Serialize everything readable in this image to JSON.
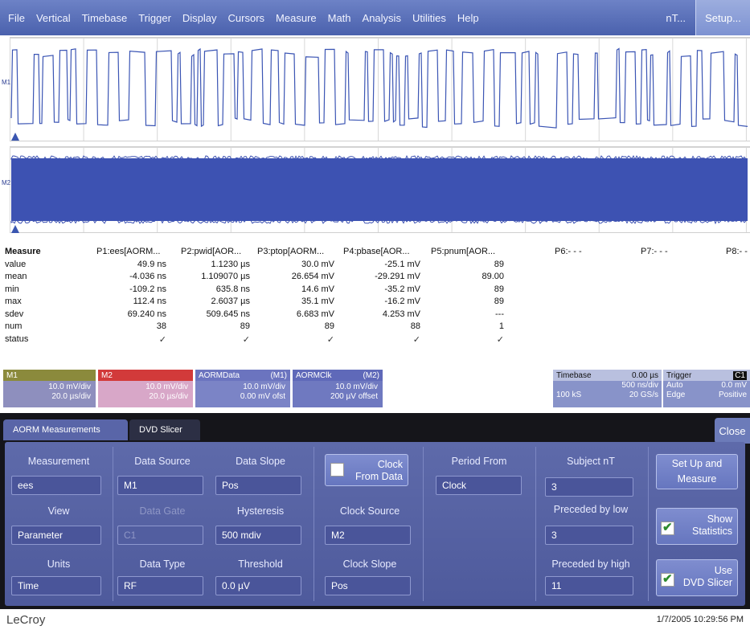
{
  "menu": {
    "items": [
      "File",
      "Vertical",
      "Timebase",
      "Trigger",
      "Display",
      "Cursors",
      "Measure",
      "Math",
      "Analysis",
      "Utilities",
      "Help"
    ],
    "nt_label": "nT...",
    "setup_label": "Setup..."
  },
  "waveforms": {
    "ch1_tag": "M1",
    "ch2_tag": "M2"
  },
  "measure": {
    "heading": "Measure",
    "params": [
      "P1:ees[AORM...",
      "P2:pwid[AOR...",
      "P3:ptop[AORM...",
      "P4:pbase[AOR...",
      "P5:pnum[AOR...",
      "P6:- - -",
      "P7:- - -",
      "P8:- -"
    ],
    "rows": [
      {
        "label": "value",
        "cells": [
          "49.9 ns",
          "1.1230 µs",
          "30.0 mV",
          "-25.1 mV",
          "89"
        ]
      },
      {
        "label": "mean",
        "cells": [
          "-4.036 ns",
          "1.109070 µs",
          "26.654 mV",
          "-29.291 mV",
          "89.00"
        ]
      },
      {
        "label": "min",
        "cells": [
          "-109.2 ns",
          "635.8 ns",
          "14.6 mV",
          "-35.2 mV",
          "89"
        ]
      },
      {
        "label": "max",
        "cells": [
          "112.4 ns",
          "2.6037 µs",
          "35.1 mV",
          "-16.2 mV",
          "89"
        ]
      },
      {
        "label": "sdev",
        "cells": [
          "69.240 ns",
          "509.645 ns",
          "6.683 mV",
          "4.253 mV",
          "---"
        ]
      },
      {
        "label": "num",
        "cells": [
          "38",
          "89",
          "89",
          "88",
          "1"
        ]
      },
      {
        "label": "status",
        "cells": [
          "✓",
          "✓",
          "✓",
          "✓",
          "✓"
        ]
      }
    ]
  },
  "descriptors": {
    "m1": {
      "name": "M1",
      "line1": "10.0 mV/div",
      "line2": "20.0 µs/div",
      "header_color": "#8b8a3c"
    },
    "m2": {
      "name": "M2",
      "line1": "10.0 mV/div",
      "line2": "20.0 µs/div",
      "header_color": "#d23a3a"
    },
    "data": {
      "name": "AORMData",
      "src": "(M1)",
      "line1": "10.0 mV/div",
      "line2": "0.00 mV ofst"
    },
    "clk": {
      "name": "AORMClk",
      "src": "(M2)",
      "line1": "10.0 mV/div",
      "line2": "200 µV offset"
    },
    "timebase": {
      "title": "Timebase",
      "delay": "0.00 µs",
      "div": "500 ns/div",
      "samples": "100 kS",
      "rate": "20 GS/s"
    },
    "trigger": {
      "title": "Trigger",
      "ch": "C1",
      "mode": "Auto",
      "level": "0.0 mV",
      "type": "Edge",
      "slope": "Positive"
    }
  },
  "dialog": {
    "tabs": [
      "AORM Measurements",
      "DVD Slicer"
    ],
    "close_label": "Close",
    "measurement_label": "Measurement",
    "measurement_value": "ees",
    "view_label": "View",
    "view_value": "Parameter",
    "units_label": "Units",
    "units_value": "Time",
    "data_source_label": "Data Source",
    "data_source_value": "M1",
    "data_gate_label": "Data Gate",
    "data_gate_value": "C1",
    "data_type_label": "Data Type",
    "data_type_value": "RF",
    "data_slope_label": "Data Slope",
    "data_slope_value": "Pos",
    "hysteresis_label": "Hysteresis",
    "hysteresis_value": "500 mdiv",
    "threshold_label": "Threshold",
    "threshold_value": "0.0 µV",
    "clock_from_data_line1": "Clock",
    "clock_from_data_line2": "From Data",
    "clock_source_label": "Clock Source",
    "clock_source_value": "M2",
    "clock_slope_label": "Clock Slope",
    "clock_slope_value": "Pos",
    "period_from_label": "Period From",
    "period_from_value": "Clock",
    "subject_nt_label": "Subject nT",
    "subject_nt_value": "3",
    "preceded_low_label": "Preceded by low",
    "preceded_low_value": "3",
    "preceded_high_label": "Preceded by high",
    "preceded_high_value": "11",
    "setup_measure_line1": "Set Up and",
    "setup_measure_line2": "Measure",
    "show_stats_line1": "Show",
    "show_stats_line2": "Statistics",
    "show_stats_checked": true,
    "use_dvd_line1": "Use",
    "use_dvd_line2": "DVD Slicer",
    "use_dvd_checked": true
  },
  "footer": {
    "logo": "LeCroy",
    "datetime": "1/7/2005 10:29:56 PM"
  }
}
